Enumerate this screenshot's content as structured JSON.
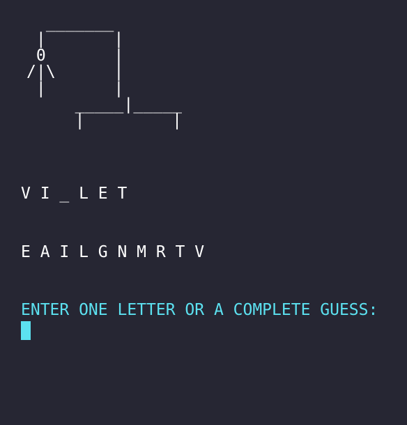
{
  "gallows_art": "   _______\n  |       |\n  0       |\n /|\\      |\n  |       |\n      _____|_____\n      |         |",
  "word_display": "V I _ L E T",
  "guessed_letters": "E A I L G N M R T V",
  "prompt": "ENTER ONE LETTER OR A COMPLETE GUESS:",
  "input_value": "",
  "colors": {
    "background": "#262633",
    "text": "#ffffff",
    "accent": "#5ce1f0"
  }
}
